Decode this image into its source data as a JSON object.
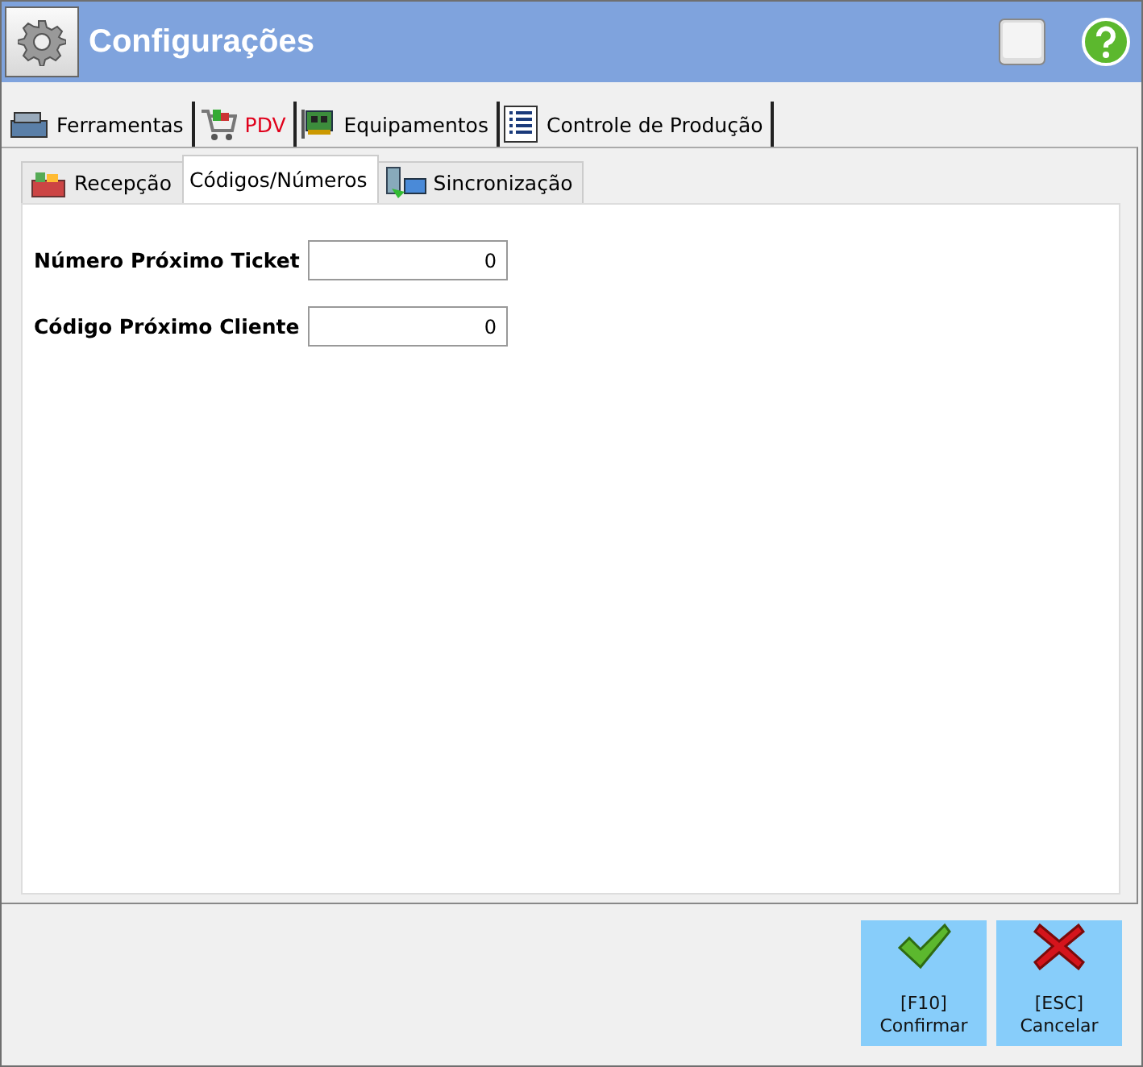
{
  "window": {
    "title": "Configurações"
  },
  "tabs": [
    {
      "label": "Ferramentas",
      "selected": false
    },
    {
      "label": "PDV",
      "selected": true
    },
    {
      "label": "Equipamentos",
      "selected": false
    },
    {
      "label": "Controle de Produção",
      "selected": false
    }
  ],
  "subtabs": [
    {
      "label": "Recepção",
      "selected": false
    },
    {
      "label": "Códigos/Números",
      "selected": true
    },
    {
      "label": "Sincronização",
      "selected": false
    }
  ],
  "fields": [
    {
      "label": "Número Próximo Ticket",
      "value": "0"
    },
    {
      "label": "Código Próximo Cliente",
      "value": "0"
    }
  ],
  "buttons": [
    {
      "kind": "confirm",
      "key": "[F10]",
      "label": "Confirmar"
    },
    {
      "kind": "cancel",
      "key": "[ESC]",
      "label": "Cancelar"
    }
  ]
}
